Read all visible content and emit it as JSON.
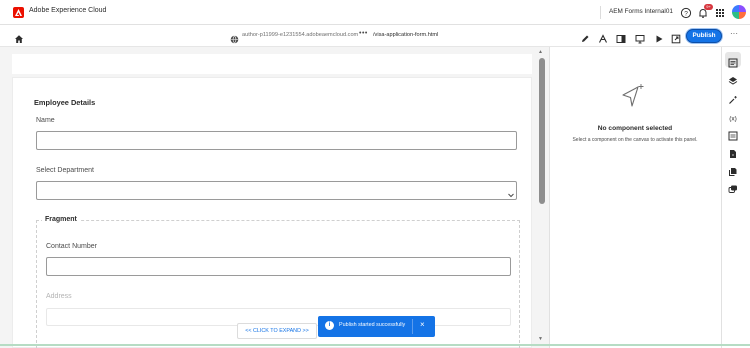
{
  "shell": {
    "app_title": "Adobe Experience Cloud",
    "org_name": "AEM Forms Internal01",
    "notification_count": "9+"
  },
  "toolbar": {
    "url_host": "author-p11999-e1231554.adobeaemcloud.com",
    "url_more": "•••",
    "url_path": "/visa-application-form.html",
    "publish_label": "Publish",
    "more_label": "···"
  },
  "form": {
    "section_title": "Employee Details",
    "name_label": "Name",
    "name_value": "",
    "department_label": "Select Department",
    "department_value": "",
    "fragment_legend": "Fragment",
    "contact_label": "Contact Number",
    "contact_value": "",
    "address_label": "Address"
  },
  "notices": {
    "expand_label": "<< CLICK TO EXPAND >>",
    "toast_text": "Publish started successfully",
    "toast_close": "×",
    "toast_info": "i"
  },
  "panel": {
    "empty_title": "No component selected",
    "empty_subtitle": "Select a component on the canvas to activate this panel."
  },
  "rail": {
    "items": [
      "properties-icon",
      "layers-icon",
      "magic-wand-icon",
      "variables-icon",
      "form-icon",
      "document-icon",
      "fragments-icon",
      "link-icon"
    ]
  },
  "colors": {
    "accent": "#1473e6",
    "adobe_red": "#eb1000",
    "badge_red": "#d7373f"
  }
}
